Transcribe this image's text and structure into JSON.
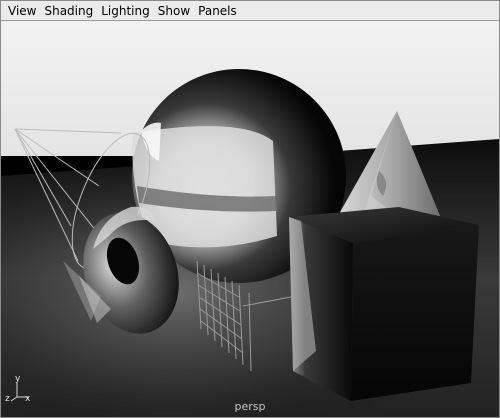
{
  "menubar": {
    "items": [
      {
        "label": "View"
      },
      {
        "label": "Shading"
      },
      {
        "label": "Lighting"
      },
      {
        "label": "Show"
      },
      {
        "label": "Panels"
      }
    ]
  },
  "viewport": {
    "camera_label": "persp",
    "axis": {
      "y": "y",
      "z": "z",
      "x": "x"
    },
    "objects": [
      "sphere",
      "cone",
      "cube",
      "torus",
      "spot-light",
      "area-light"
    ]
  }
}
